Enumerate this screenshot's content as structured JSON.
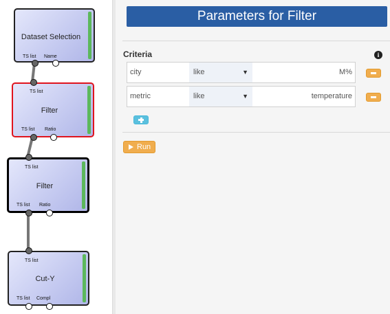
{
  "nodes": [
    {
      "title": "Dataset Selection",
      "outputs": [
        "TS list",
        "Name"
      ]
    },
    {
      "title": "Filter",
      "input": "TS list",
      "outputs": [
        "TS list",
        "Ratio"
      ]
    },
    {
      "title": "Filter",
      "input": "TS list",
      "outputs": [
        "TS list",
        "Ratio"
      ]
    },
    {
      "title": "Cut-Y",
      "input": "TS list",
      "outputs": [
        "TS list",
        "Compl"
      ]
    }
  ],
  "panel": {
    "title": "Parameters for Filter",
    "criteria_label": "Criteria",
    "info_glyph": "i",
    "criteria": [
      {
        "field": "city",
        "operator": "like",
        "value": "M%"
      },
      {
        "field": "metric",
        "operator": "like",
        "value": "temperature"
      }
    ],
    "caret_glyph": "▼",
    "run_label": "Run"
  },
  "colors": {
    "title_bar": "#2a5ea4",
    "selected_border": "#e0131d",
    "status_bar": "#5cb85c",
    "remove_button": "#f0ad4e",
    "add_button": "#5bc0de"
  },
  "icons": [
    "info-icon",
    "minus-icon",
    "plus-icon",
    "play-icon"
  ]
}
